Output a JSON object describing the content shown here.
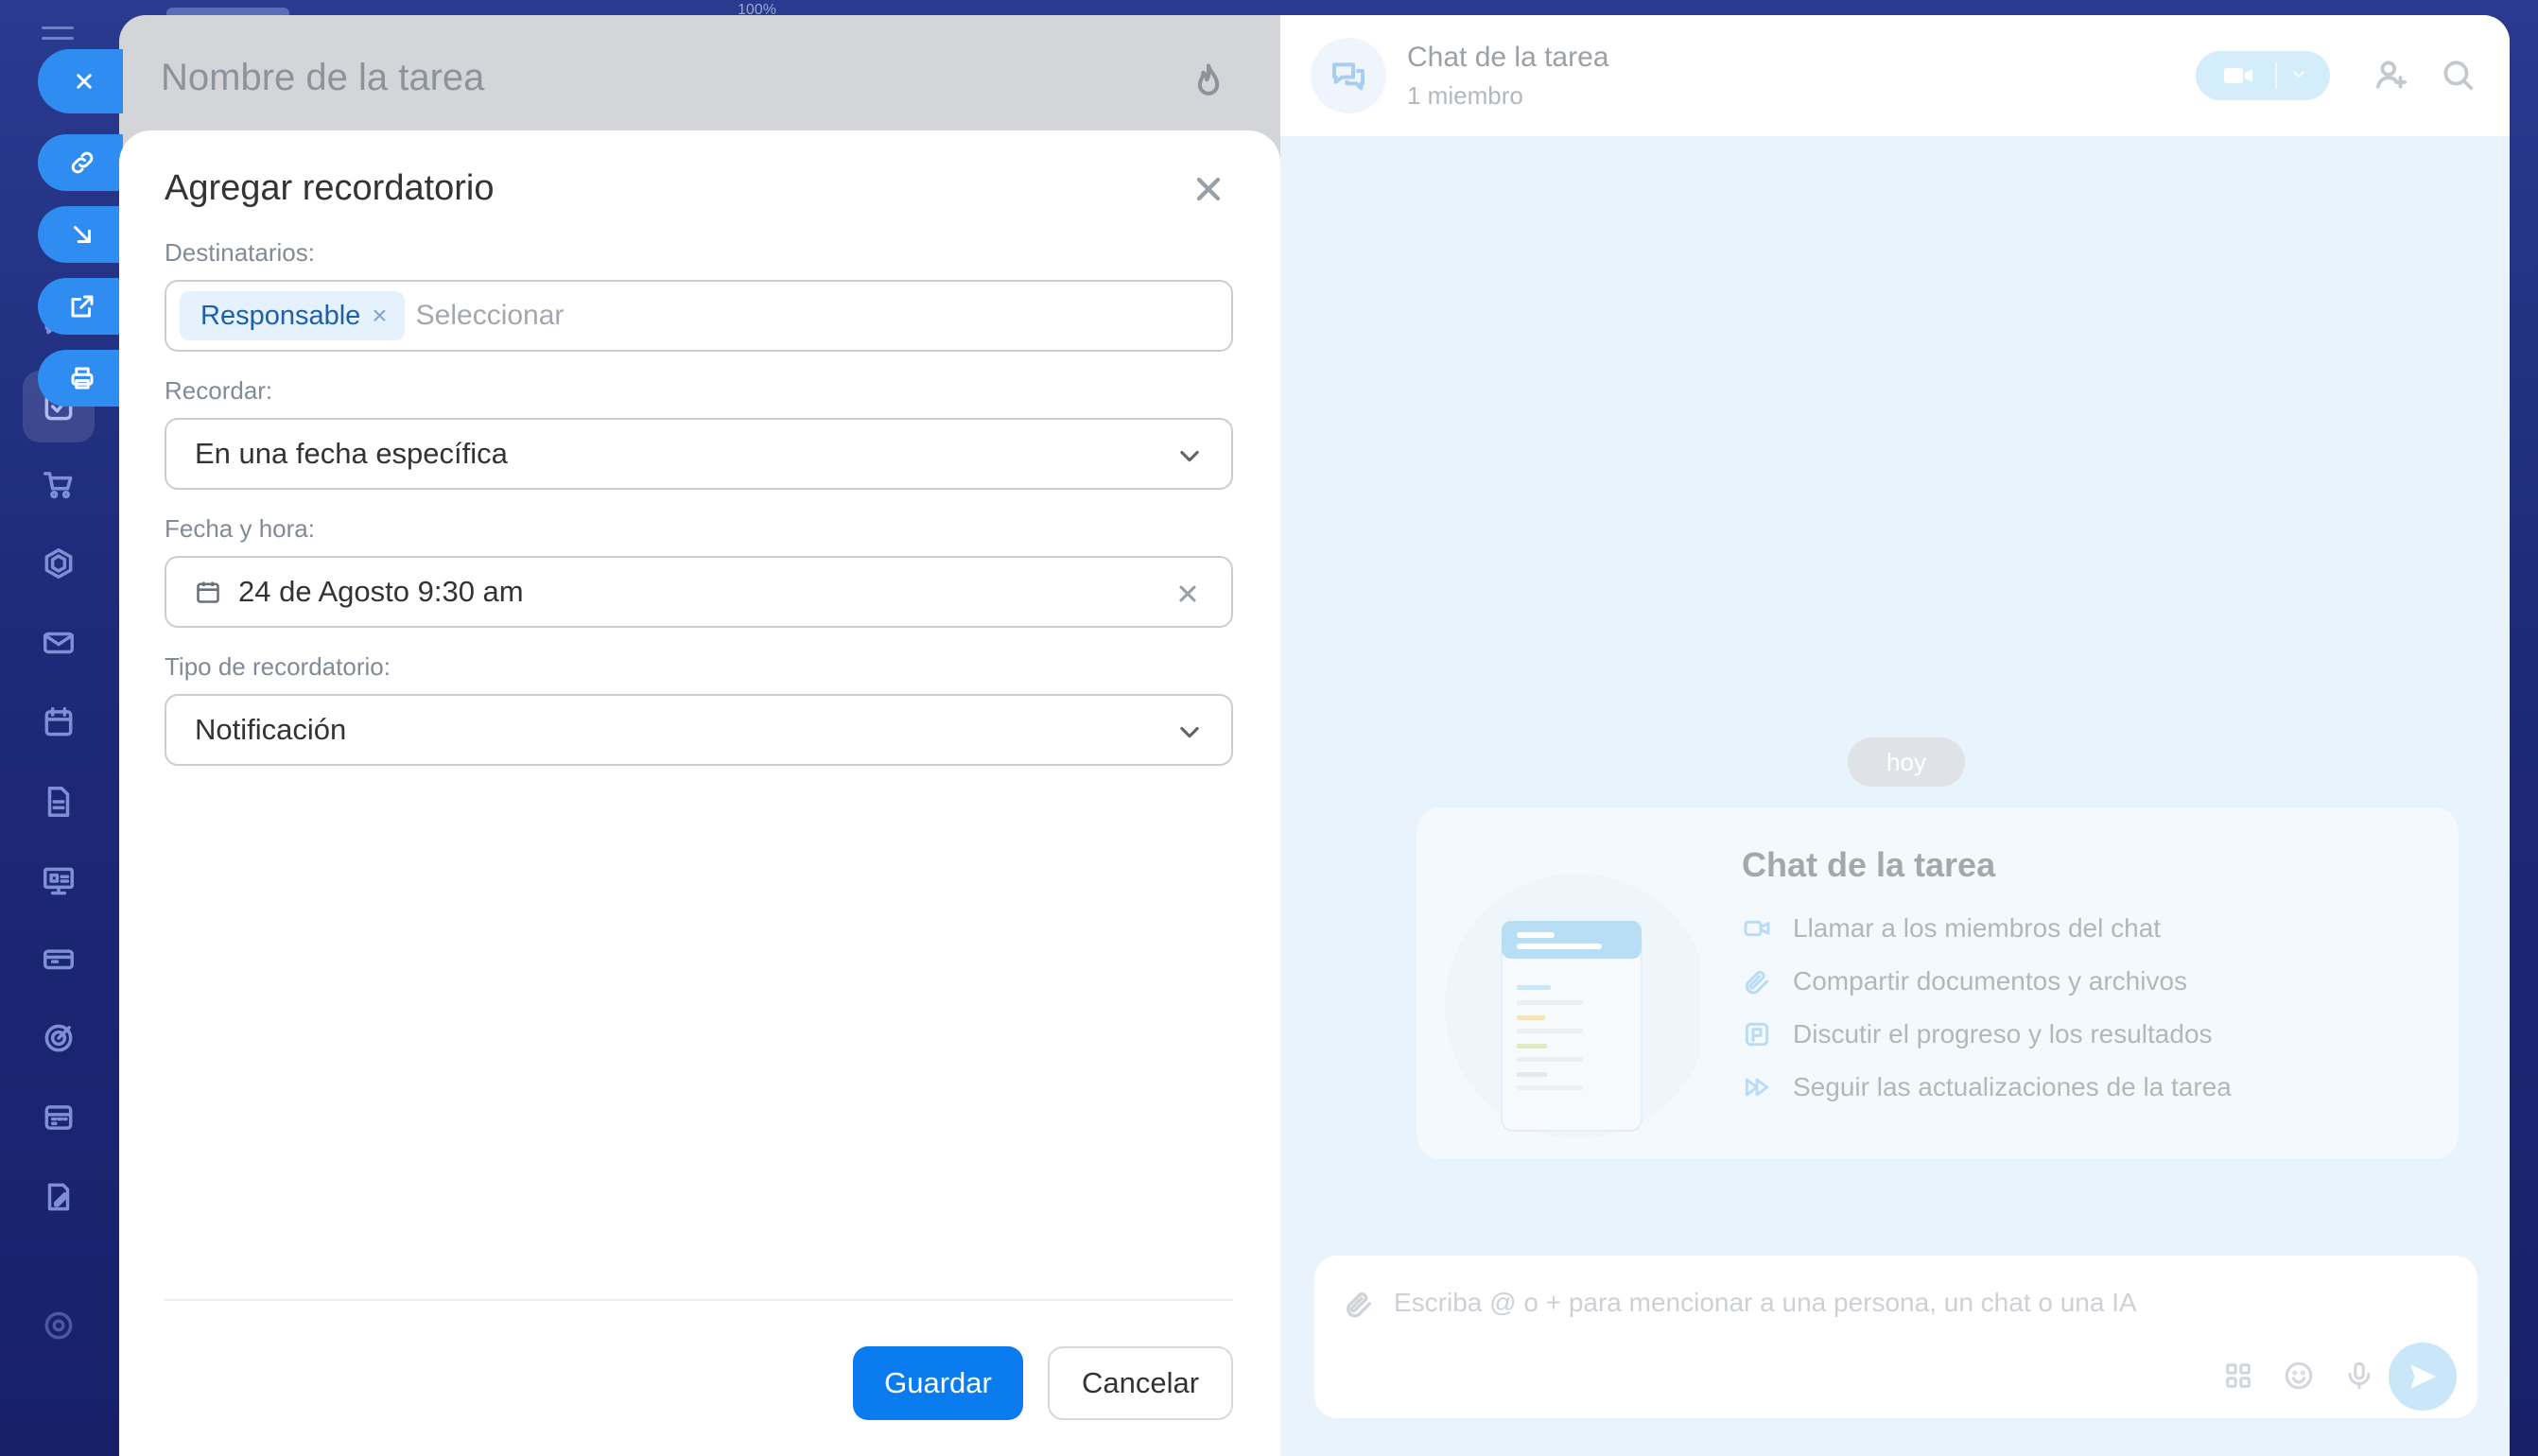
{
  "browser": {
    "zoom": "100%"
  },
  "task": {
    "title": "Nombre de la tarea"
  },
  "modal": {
    "title": "Agregar recordatorio",
    "recipients_label": "Destinatarios:",
    "recipient_chip": "Responsable",
    "recipients_placeholder": "Seleccionar",
    "remind_label": "Recordar:",
    "remind_value": "En una fecha específica",
    "datetime_label": "Fecha y hora:",
    "datetime_value": "24 de Agosto 9:30 am",
    "type_label": "Tipo de recordatorio:",
    "type_value": "Notificación",
    "save_label": "Guardar",
    "cancel_label": "Cancelar"
  },
  "chat": {
    "title": "Chat de la tarea",
    "members": "1 miembro",
    "date_separator": "hoy",
    "welcome_title": "Chat de la tarea",
    "features": [
      "Llamar a los miembros del chat",
      "Compartir documentos y archivos",
      "Discutir el progreso y los resultados",
      "Seguir las actualizaciones de la tarea"
    ],
    "composer_placeholder": "Escriba @ o + para mencionar a una persona, un chat o una IA"
  },
  "sidebar": {
    "icons": [
      "feed-icon",
      "flow-icon",
      "chat-icon",
      "tasks-icon",
      "cart-icon",
      "hexagon-icon",
      "mail-icon",
      "calendar-icon",
      "document-icon",
      "board-icon",
      "inbox-icon",
      "target-icon",
      "schedule-icon",
      "edit-icon",
      "settings-icon"
    ]
  },
  "colors": {
    "accent": "#0b7cf0",
    "sidebar_bg": "#1d2a78",
    "chip_bg": "#e5f1fc"
  }
}
